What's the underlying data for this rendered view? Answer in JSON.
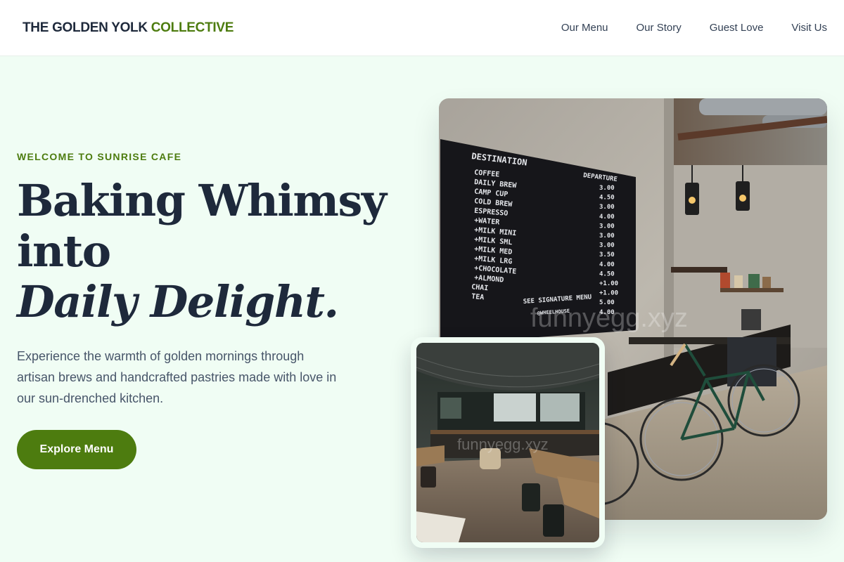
{
  "header": {
    "logo_main": "THE GOLDEN YOLK",
    "logo_accent": "COLLECTIVE",
    "nav": [
      {
        "label": "Our Menu"
      },
      {
        "label": "Our Story"
      },
      {
        "label": "Guest Love"
      },
      {
        "label": "Visit Us"
      }
    ]
  },
  "hero": {
    "eyebrow": "WELCOME TO SUNRISE CAFE",
    "headline_line1": "Baking Whimsy",
    "headline_line2": "into",
    "headline_line3": "Daily Delight.",
    "subcopy": "Experience the warmth of golden mornings through artisan brews and handcrafted pastries made with love in our sun-drenched kitchen.",
    "cta_label": "Explore Menu"
  },
  "images": {
    "main_photo": {
      "board_title": "DESTINATION",
      "board_col": "DEPARTURE",
      "board_items": [
        "COFFEE",
        "DAILY BREW",
        "CAMP CUP",
        "COLD BREW",
        "ESPRESSO",
        "+WATER",
        "+MILK MINI",
        "+MILK SML",
        "+MILK MED",
        "+MILK LRG",
        "+CHOCOLATE",
        "+ALMOND",
        "CHAI",
        "TEA"
      ],
      "board_prices": [
        "3.00",
        "4.50",
        "3.00",
        "4.00",
        "3.00",
        "3.00",
        "3.00",
        "3.50",
        "4.00",
        "4.50",
        "+1.00",
        "+1.00",
        "5.00",
        "4.00"
      ],
      "board_footer": "SEE SIGNATURE MENU",
      "board_brand": "@WHEELHOUSE",
      "watermark": "funnyegg.xyz"
    },
    "inset_photo": {
      "watermark": "funnyegg.xyz"
    }
  },
  "colors": {
    "accent": "#4d7c0f",
    "background": "#f0fdf4",
    "text_dark": "#1e293b"
  }
}
